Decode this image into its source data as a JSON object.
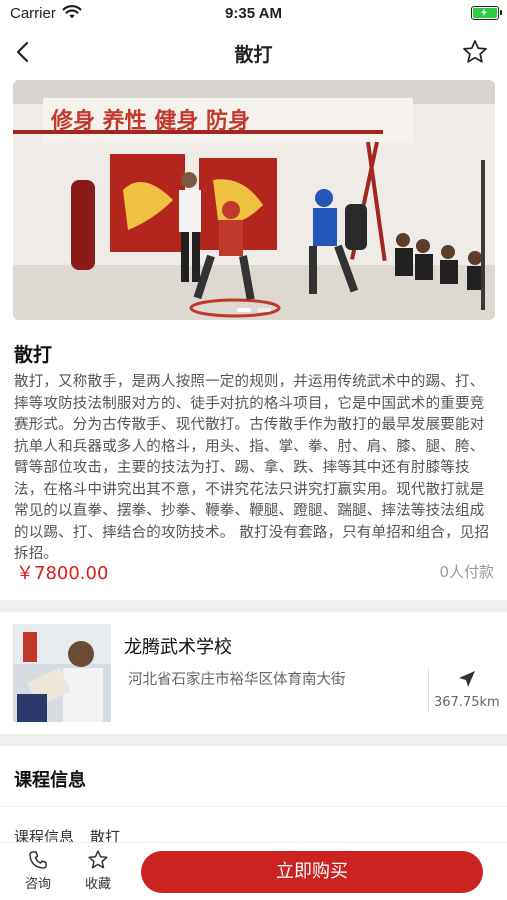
{
  "status_bar": {
    "carrier": "Carrier",
    "time": "9:35 AM",
    "wifi_icon": "wifi-icon",
    "battery_icon": "battery-charging-icon",
    "battery_color": "#2ecc40"
  },
  "nav": {
    "title": "散打",
    "back_icon": "chevron-left-icon",
    "favorite_icon": "star-outline-icon"
  },
  "hero": {
    "banner_text": "修身 养性 健身 防身",
    "carousel_pages": 2,
    "carousel_active": 0
  },
  "course": {
    "title": "散打",
    "description": "散打，又称散手，是两人按照一定的规则，并运用传统武术中的踢、打、摔等攻防技法制服对方的、徒手对抗的格斗项目，它是中国武术的重要竞赛形式。分为古传散手、现代散打。古传散手作为散打的最早发展要能对抗单人和兵器或多人的格斗，用头、指、掌、拳、肘、肩、膝、腿、胯、臂等部位攻击，主要的技法为打、踢、拿、跌、摔等其中还有肘膝等技法，在格斗中讲究出其不意，不讲究花法只讲究打赢实用。现代散打就是常见的以直拳、摆拳、抄拳、鞭拳、鞭腿、蹬腿、踹腿、摔法等技法组成的以踢、打、摔结合的攻防技术。 散打没有套路，只有单招和组合，见招拆招。",
    "price": "￥7800.00",
    "paid_count": "0人付款"
  },
  "school": {
    "name": "龙腾武术学校",
    "address": "河北省石家庄市裕华区体育南大街",
    "distance": "367.75km",
    "navigate_icon": "location-arrow-icon"
  },
  "course_info": {
    "section_title": "课程信息",
    "rows": [
      {
        "label": "课程信息",
        "value": "散打"
      }
    ]
  },
  "bottom_bar": {
    "consult_label": "咨询",
    "consult_icon": "phone-icon",
    "favorite_label": "收藏",
    "favorite_icon": "star-outline-icon",
    "buy_label": "立即购买",
    "accent_color": "#cc2222"
  },
  "colors": {
    "price_red": "#d81e1e",
    "separator": "#f0f0f0"
  }
}
